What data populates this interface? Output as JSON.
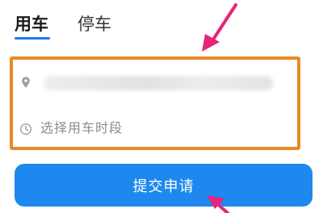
{
  "tabs": [
    {
      "label": "用车",
      "active": true
    },
    {
      "label": "停车",
      "active": false
    }
  ],
  "form": {
    "destination_icon": "location-pin-icon",
    "time_icon": "clock-icon",
    "time_placeholder": "选择用车时段"
  },
  "submit_label": "提交申请",
  "colors": {
    "accent": "#1f7cf0",
    "button": "#1e88ee",
    "highlight_box": "#e88a24",
    "annotation_arrow": "#e6247a"
  }
}
